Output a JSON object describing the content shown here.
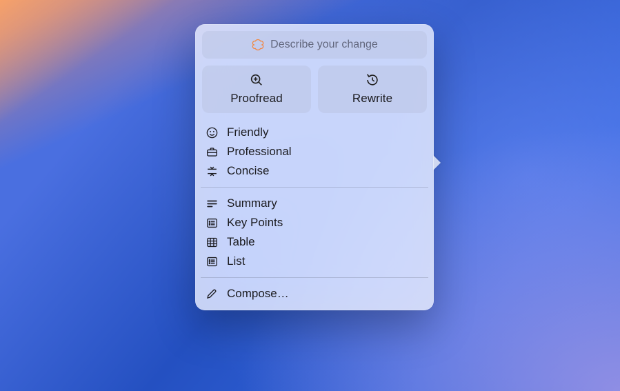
{
  "input": {
    "placeholder": "Describe your change"
  },
  "buttons": {
    "proofread": "Proofread",
    "rewrite": "Rewrite"
  },
  "tone_items": [
    {
      "label": "Friendly"
    },
    {
      "label": "Professional"
    },
    {
      "label": "Concise"
    }
  ],
  "format_items": [
    {
      "label": "Summary"
    },
    {
      "label": "Key Points"
    },
    {
      "label": "Table"
    },
    {
      "label": "List"
    }
  ],
  "compose": {
    "label": "Compose…"
  }
}
